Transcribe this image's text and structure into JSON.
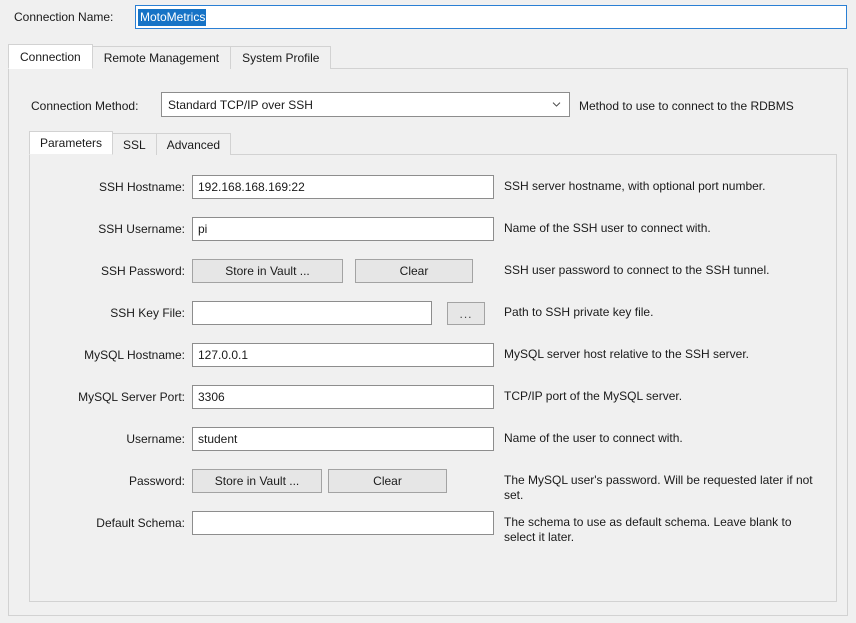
{
  "connection_name": {
    "label": "Connection Name:",
    "value": "MotoMetrics",
    "selected": true
  },
  "tabs": [
    {
      "label": "Connection",
      "active": true
    },
    {
      "label": "Remote Management",
      "active": false
    },
    {
      "label": "System Profile",
      "active": false
    }
  ],
  "connection_method": {
    "label": "Connection Method:",
    "value": "Standard TCP/IP over SSH",
    "help": "Method to use to connect to the RDBMS",
    "icon": "chevron-down-icon"
  },
  "inner_tabs": [
    {
      "label": "Parameters",
      "active": true
    },
    {
      "label": "SSL",
      "active": false
    },
    {
      "label": "Advanced",
      "active": false
    }
  ],
  "fields": {
    "ssh_hostname": {
      "label": "SSH Hostname:",
      "value": "192.168.168.169:22",
      "help": "SSH server hostname, with  optional port number."
    },
    "ssh_username": {
      "label": "SSH Username:",
      "value": "pi",
      "help": "Name of the SSH user to connect with."
    },
    "ssh_password": {
      "label": "SSH Password:",
      "store_label": "Store in Vault ...",
      "clear_label": "Clear",
      "help": "SSH user password to connect to the SSH tunnel."
    },
    "ssh_key_file": {
      "label": "SSH Key File:",
      "value": "",
      "browse_label": "...",
      "help": "Path to SSH private key file."
    },
    "mysql_hostname": {
      "label": "MySQL Hostname:",
      "value": "127.0.0.1",
      "help": "MySQL server host relative to the SSH server."
    },
    "mysql_server_port": {
      "label": "MySQL Server Port:",
      "value": "3306",
      "help": "TCP/IP port of the MySQL server."
    },
    "username": {
      "label": "Username:",
      "value": "student",
      "help": "Name of the user to connect with."
    },
    "password": {
      "label": "Password:",
      "store_label": "Store in Vault ...",
      "clear_label": "Clear",
      "help": "The MySQL user's password. Will be requested later if not set."
    },
    "default_schema": {
      "label": "Default Schema:",
      "value": "",
      "help": "The schema to use as default schema. Leave blank to select it later."
    }
  }
}
